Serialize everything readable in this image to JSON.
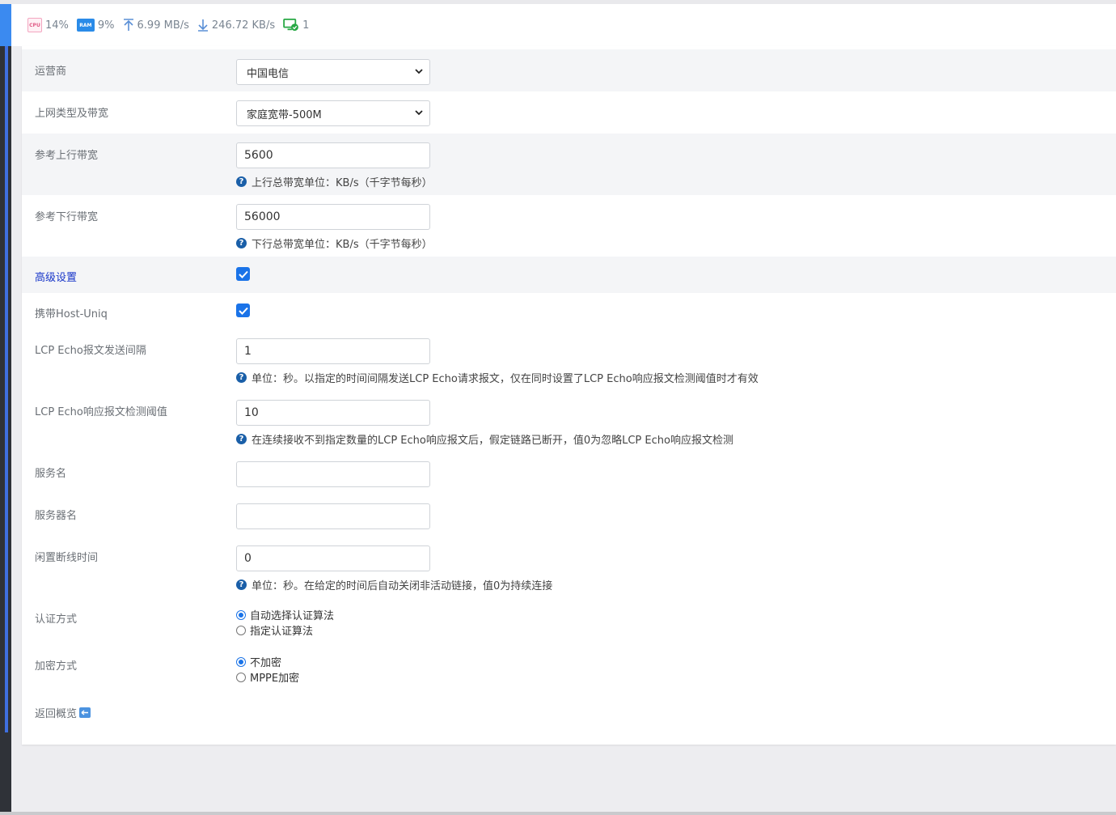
{
  "statusbar": {
    "cpu_label": "CPU",
    "cpu": "14%",
    "ram_label": "RAM",
    "ram": "9%",
    "upload": "6.99 MB/s",
    "download": "246.72 KB/s",
    "connections": "1"
  },
  "form": {
    "isp": {
      "label": "运营商",
      "value": "中国电信"
    },
    "net_type": {
      "label": "上网类型及带宽",
      "value": "家庭宽带-500M"
    },
    "up_bw": {
      "label": "参考上行带宽",
      "value": "5600",
      "help": "上行总带宽单位：KB/s（千字节每秒）"
    },
    "down_bw": {
      "label": "参考下行带宽",
      "value": "56000",
      "help": "下行总带宽单位：KB/s（千字节每秒）"
    },
    "advanced": {
      "label": "高级设置",
      "checked": true
    },
    "host_uniq": {
      "label": "携带Host-Uniq",
      "checked": true
    },
    "lcp_interval": {
      "label": "LCP Echo报文发送间隔",
      "value": "1",
      "help": "单位：秒。以指定的时间间隔发送LCP Echo请求报文，仅在同时设置了LCP Echo响应报文检测阈值时才有效"
    },
    "lcp_threshold": {
      "label": "LCP Echo响应报文检测阈值",
      "value": "10",
      "help": "在连续接收不到指定数量的LCP Echo响应报文后，假定链路已断开，值0为忽略LCP Echo响应报文检测"
    },
    "service_name": {
      "label": "服务名",
      "value": ""
    },
    "server_name": {
      "label": "服务器名",
      "value": ""
    },
    "idle": {
      "label": "闲置断线时间",
      "value": "0",
      "help": "单位：秒。在给定的时间后自动关闭非活动链接，值0为持续连接"
    },
    "auth": {
      "label": "认证方式",
      "options": [
        "自动选择认证算法",
        "指定认证算法"
      ],
      "selected": "自动选择认证算法"
    },
    "encrypt": {
      "label": "加密方式",
      "options": [
        "不加密",
        "MPPE加密"
      ],
      "selected": "不加密"
    }
  },
  "back_label": "返回概览",
  "colors": {
    "accent": "#1a73e8",
    "advanced_label": "#1836c9",
    "help_icon": "#1a5fa8"
  }
}
